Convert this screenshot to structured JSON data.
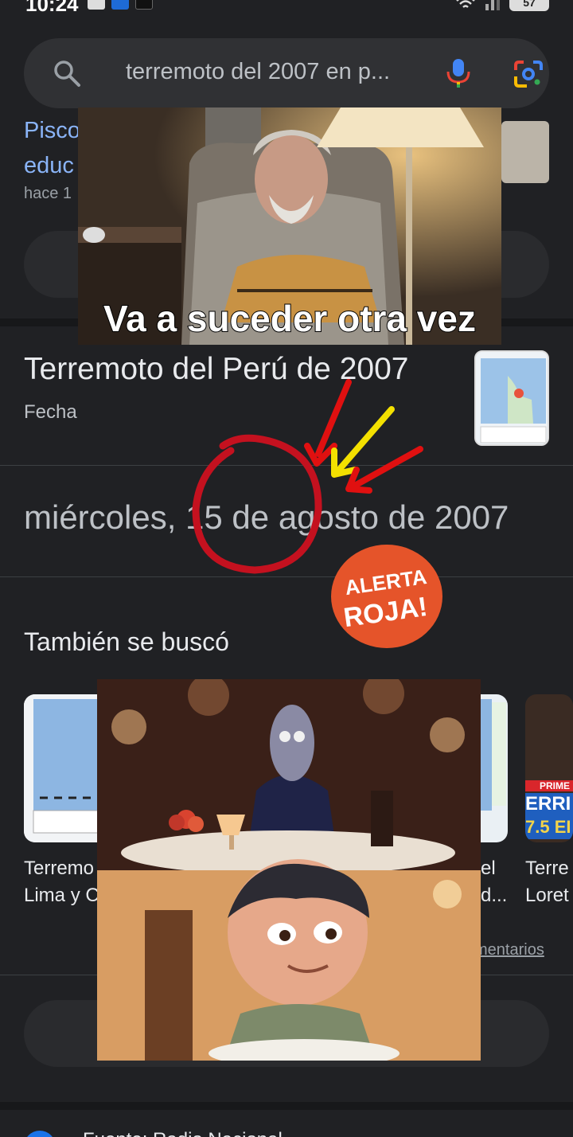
{
  "status_bar": {
    "time": "10:24",
    "battery": "57"
  },
  "search": {
    "query": "terremoto del 2007 en p..."
  },
  "background_result": {
    "title_line1": "Pisco",
    "title_line2": "educ",
    "meta": "hace 1"
  },
  "knowledge": {
    "title": "Terremoto del Perú de 2007",
    "subtitle": "Fecha",
    "date": "miércoles, 15 de agosto de 2007"
  },
  "also_searched": {
    "heading": "También se buscó",
    "cards": [
      {
        "label_line1": "Terremo",
        "label_line2": "Lima y C"
      },
      {
        "label_line1": "el",
        "label_line2": "d..."
      },
      {
        "label_line1": "Terre",
        "label_line2": "Loret"
      }
    ],
    "news_badge_line1": "PRIME",
    "news_badge_line2": "ERRI",
    "news_badge_line3": "7.5 EI",
    "feedback": "mentarios"
  },
  "bottom": {
    "source_text": "Fuente: Radio Nacional"
  },
  "meme": {
    "caption": "Va a suceder otra vez",
    "badge_line1": "ALERTA",
    "badge_line2": "ROJA!"
  },
  "colors": {
    "background": "#202124",
    "link": "#8ab4f8",
    "annotation_red": "#d0021b",
    "annotation_yellow": "#f5e100",
    "badge": "#e5542a"
  }
}
